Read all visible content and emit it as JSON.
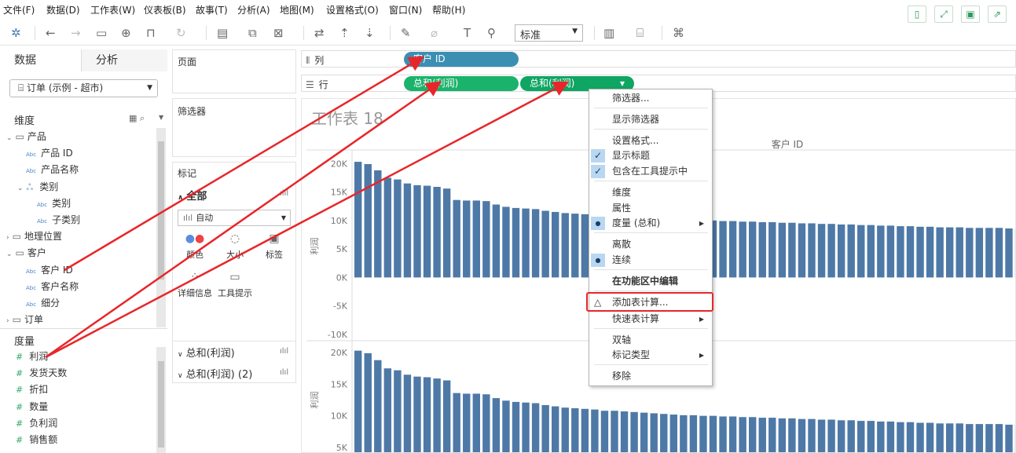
{
  "menu": [
    "文件(F)",
    "数据(D)",
    "工作表(W)",
    "仪表板(B)",
    "故事(T)",
    "分析(A)",
    "地图(M)",
    "设置格式(O)",
    "窗口(N)",
    "帮助(H)"
  ],
  "toolbar": {
    "fit_value": "标准"
  },
  "left_panel": {
    "tabs": [
      "数据",
      "分析"
    ],
    "datasource": "订单 (示例 - 超市)",
    "dimensions_header": "维度",
    "dimensions": [
      {
        "label": "产品",
        "kind": "folder",
        "level": 0
      },
      {
        "label": "产品 ID",
        "kind": "abc",
        "level": 1
      },
      {
        "label": "产品名称",
        "kind": "abc",
        "level": 1
      },
      {
        "label": "类别",
        "kind": "hier",
        "level": 1
      },
      {
        "label": "类别",
        "kind": "abc",
        "level": 2
      },
      {
        "label": "子类别",
        "kind": "abc",
        "level": 2
      },
      {
        "label": "地理位置",
        "kind": "folder",
        "level": 0
      },
      {
        "label": "客户",
        "kind": "folder",
        "level": 0
      },
      {
        "label": "客户 ID",
        "kind": "abc",
        "level": 1
      },
      {
        "label": "客户名称",
        "kind": "abc",
        "level": 1
      },
      {
        "label": "细分",
        "kind": "abc",
        "level": 1
      },
      {
        "label": "订单",
        "kind": "folder",
        "level": 0
      }
    ],
    "measures_header": "度量",
    "measures": [
      "利润",
      "发货天数",
      "折扣",
      "数量",
      "负利润",
      "销售额"
    ]
  },
  "shelves": {
    "pages": "页面",
    "filters": "筛选器",
    "marks": "标记",
    "marks_all": "全部",
    "mark_type": "自动",
    "mark_buttons": [
      "颜色",
      "大小",
      "标签",
      "详细信息",
      "工具提示"
    ],
    "mark_fields": [
      "总和(利润)",
      "总和(利润) (2)"
    ],
    "columns_label": "列",
    "rows_label": "行",
    "column_pills": [
      "客户 ID"
    ],
    "row_pills": [
      "总和(利润)",
      "总和(利润)"
    ]
  },
  "chart_data": [
    {
      "type": "bar",
      "title": "工作表 18",
      "xlabel": "客户 ID",
      "ylabel": "利润",
      "ylim": [
        -10000,
        21000
      ],
      "yticks": [
        "20K",
        "15K",
        "10K",
        "5K",
        "0K",
        "-5K",
        "-10K"
      ],
      "values": [
        20300,
        19900,
        18800,
        17500,
        17200,
        16500,
        16200,
        16100,
        15900,
        15600,
        13600,
        13500,
        13500,
        13400,
        12800,
        12400,
        12200,
        12100,
        12000,
        11700,
        11500,
        11300,
        11200,
        11100,
        11000,
        10800,
        10800,
        10700,
        10600,
        10500,
        10400,
        10300,
        10200,
        10100,
        10100,
        10000,
        10000,
        9900,
        9900,
        9800,
        9800,
        9700,
        9700,
        9600,
        9600,
        9500,
        9500,
        9400,
        9400,
        9300,
        9300,
        9200,
        9200,
        9100,
        9100,
        9000,
        9000,
        8900,
        8900,
        8800,
        8800,
        8800,
        8700,
        8700,
        8700,
        8700,
        8600,
        8600,
        8600,
        8500,
        8500,
        8500
      ]
    },
    {
      "type": "bar",
      "ylabel": "利润",
      "ylim": [
        4000,
        21000
      ],
      "yticks": [
        "20K",
        "15K",
        "10K",
        "5K"
      ],
      "values": [
        20300,
        19900,
        18800,
        17500,
        17200,
        16500,
        16200,
        16100,
        15900,
        15600,
        13600,
        13500,
        13500,
        13400,
        12800,
        12400,
        12200,
        12100,
        12000,
        11700,
        11500,
        11300,
        11200,
        11100,
        11000,
        10800,
        10800,
        10700,
        10600,
        10500,
        10400,
        10300,
        10200,
        10100,
        10100,
        10000,
        10000,
        9900,
        9900,
        9800,
        9800,
        9700,
        9700,
        9600,
        9600,
        9500,
        9500,
        9400,
        9400,
        9300,
        9300,
        9200,
        9200,
        9100,
        9100,
        9000,
        9000,
        8900,
        8900,
        8800,
        8800,
        8800,
        8700,
        8700,
        8700,
        8700,
        8600,
        8600,
        8600,
        8500,
        8500,
        8500
      ]
    }
  ],
  "context_menu": {
    "items": [
      {
        "label": "筛选器...",
        "state": ""
      },
      {
        "label": "显示筛选器",
        "state": ""
      },
      {
        "label": "设置格式...",
        "state": ""
      },
      {
        "label": "显示标题",
        "state": "check"
      },
      {
        "label": "包含在工具提示中",
        "state": "check"
      },
      {
        "label": "维度",
        "state": ""
      },
      {
        "label": "属性",
        "state": ""
      },
      {
        "label": "度量 (总和)",
        "state": "radio",
        "sub": true
      },
      {
        "label": "离散",
        "state": ""
      },
      {
        "label": "连续",
        "state": "radio"
      },
      {
        "label": "在功能区中编辑",
        "state": "bold"
      },
      {
        "label": "添加表计算...",
        "state": "highlight"
      },
      {
        "label": "快速表计算",
        "state": "",
        "sub": true
      },
      {
        "label": "双轴",
        "state": ""
      },
      {
        "label": "标记类型",
        "state": "",
        "sub": true
      },
      {
        "label": "移除",
        "state": ""
      }
    ]
  },
  "annotation_color": "#e8262a"
}
